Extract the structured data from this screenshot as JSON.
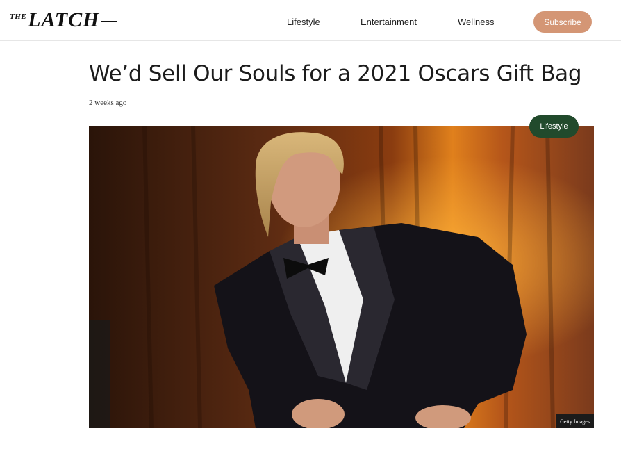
{
  "site": {
    "logo_small": "THE",
    "logo_main": "LATCH"
  },
  "nav": {
    "items": [
      {
        "label": "Lifestyle"
      },
      {
        "label": "Entertainment"
      },
      {
        "label": "Wellness"
      }
    ],
    "subscribe_label": "Subscribe"
  },
  "article": {
    "title": "We’d Sell Our Souls for a 2021 Oscars Gift Bag",
    "date": "2 weeks ago",
    "category": "Lifestyle",
    "image_credit": "Getty Images"
  },
  "colors": {
    "subscribe_bg": "#d49675",
    "category_bg": "#214a2c"
  }
}
